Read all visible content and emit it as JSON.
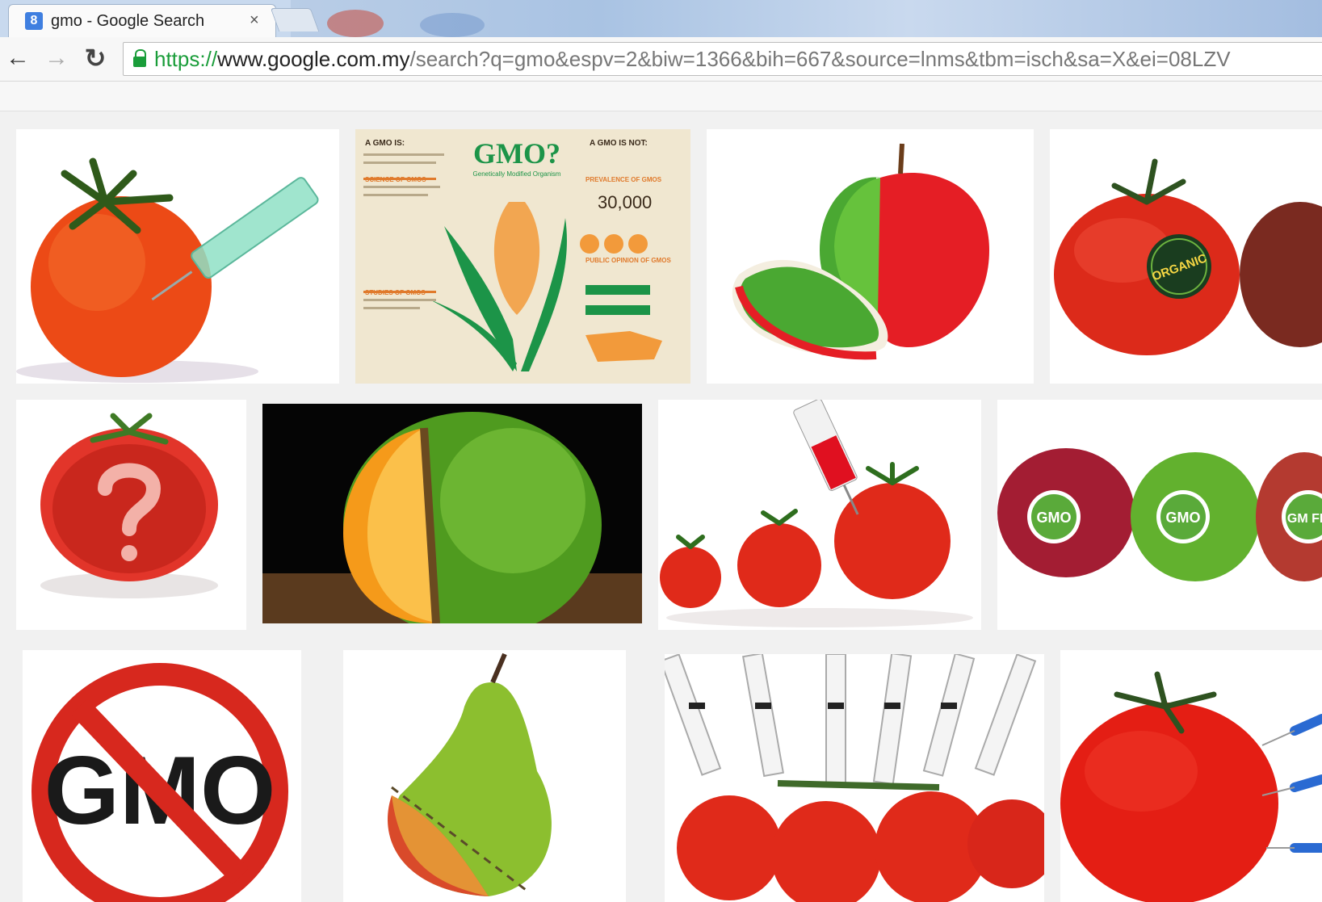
{
  "tab": {
    "title": "gmo - Google Search",
    "favicon": "8",
    "close": "×"
  },
  "toolbar": {
    "back_icon": "←",
    "forward_icon": "→",
    "reload_icon": "↻",
    "url_scheme": "https://",
    "url_host": "www.google.com.my",
    "url_path": "/search?q=gmo&espv=2&biw=1366&bih=667&source=lnms&tbm=isch&sa=X&ei=08LZV"
  },
  "results": {
    "infographic": {
      "title": "GMO?",
      "subtitle": "Genetically Modified Organism",
      "left_heading": "A GMO IS:",
      "right_heading": "A GMO IS NOT:",
      "science": "SCIENCE OF GMOS",
      "prevalence": "PREVALENCE OF GMOS",
      "stat": "30,000",
      "opinion": "PUBLIC OPINION OF GMOS",
      "studies": "STUDIES OF GMOS"
    },
    "organic_label": "ORGANIC",
    "gmo_badge_1": "GMO",
    "gmo_badge_2": "GMO",
    "gmo_badge_3": "GM FRE",
    "no_gmo_text": "GMO"
  }
}
